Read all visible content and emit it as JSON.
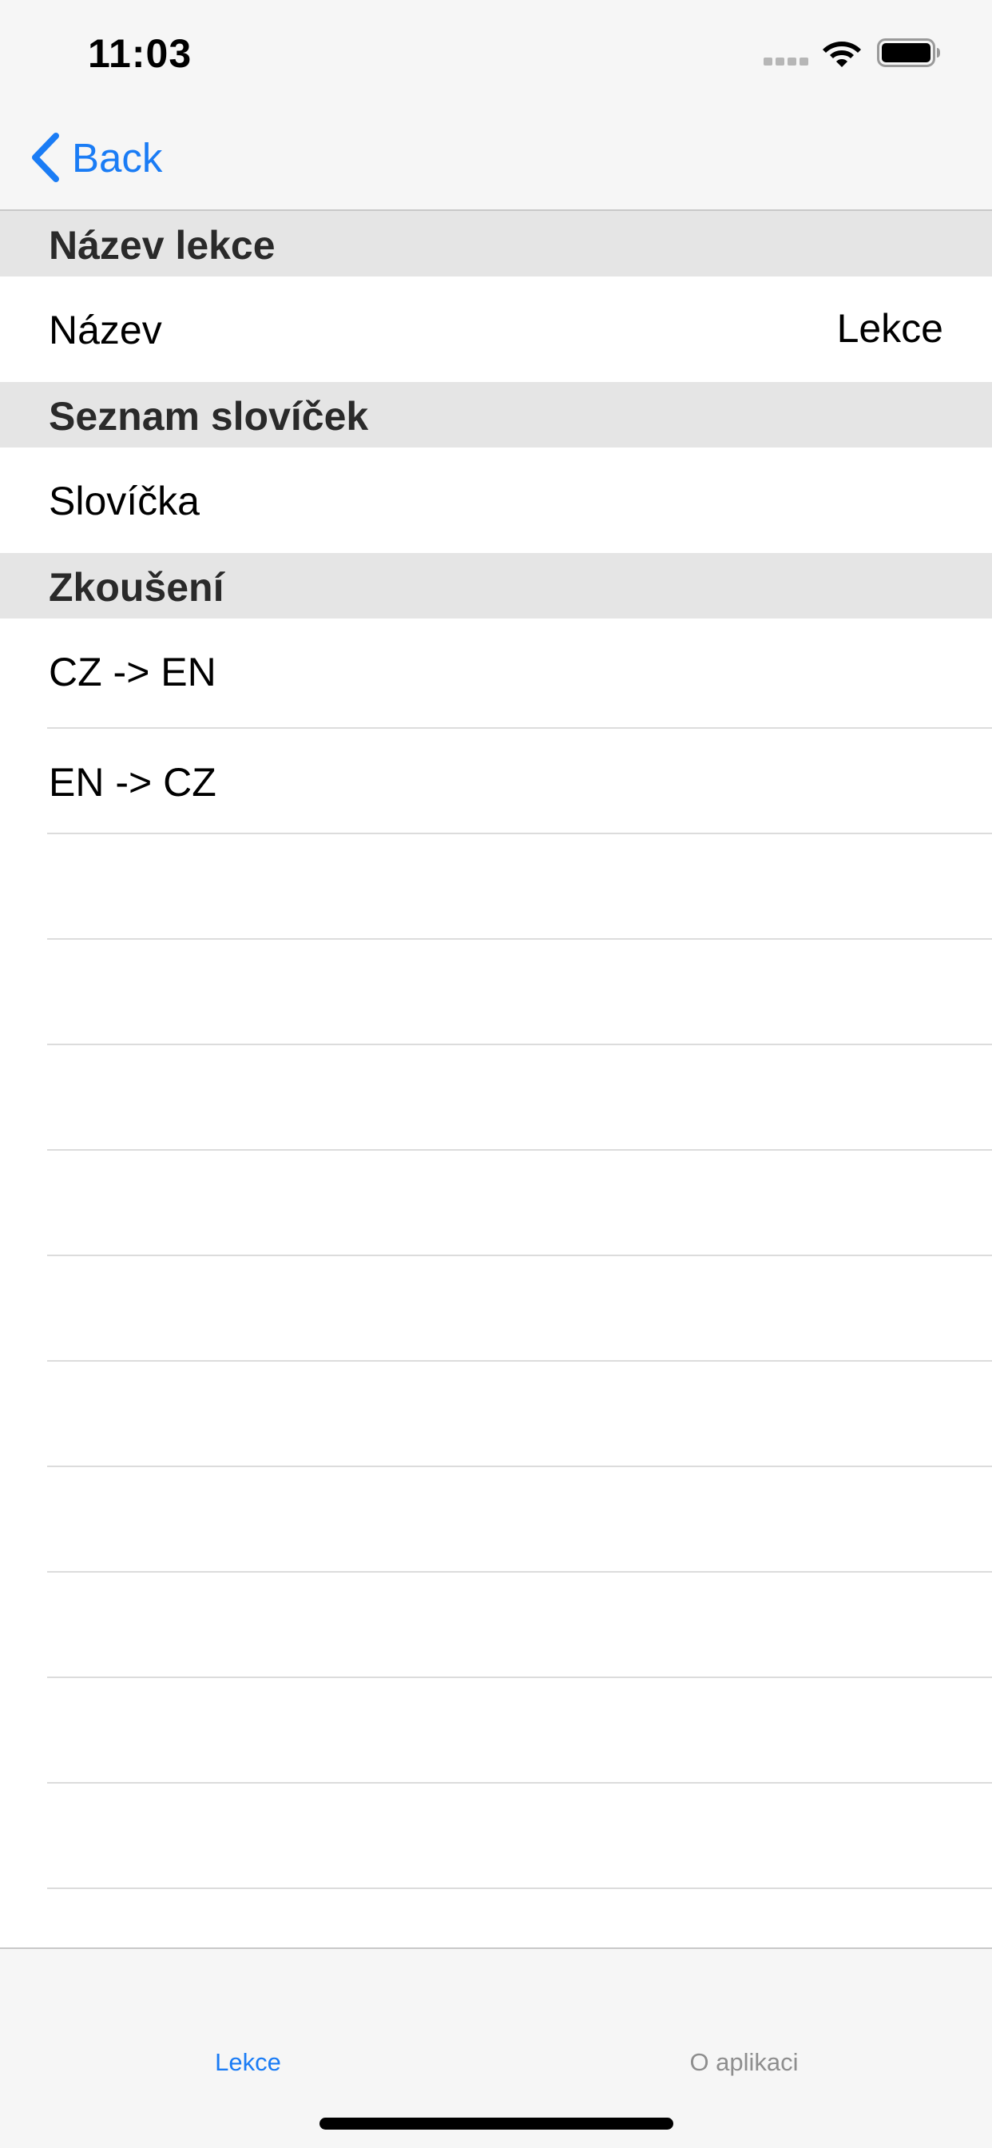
{
  "status_bar": {
    "time": "11:03",
    "icons": [
      "signal-dots-icon",
      "wifi-icon",
      "battery-icon"
    ]
  },
  "nav": {
    "back_label": "Back",
    "back_icon": "chevron-left-icon",
    "accent_color": "#1a7cf5"
  },
  "sections": [
    {
      "header": "Název lekce",
      "rows": [
        {
          "label": "Název",
          "value": "Lekce"
        }
      ]
    },
    {
      "header": "Seznam slovíček",
      "rows": [
        {
          "label": "Slovíčka"
        }
      ]
    },
    {
      "header": "Zkoušení",
      "rows": [
        {
          "label": "CZ -> EN"
        },
        {
          "label": "EN -> CZ"
        }
      ]
    }
  ],
  "tab_bar": {
    "items": [
      {
        "label": "Lekce",
        "selected": true
      },
      {
        "label": "O aplikaci",
        "selected": false
      }
    ],
    "selected_color": "#1a7cf5",
    "unselected_color": "#8e8e8e"
  }
}
